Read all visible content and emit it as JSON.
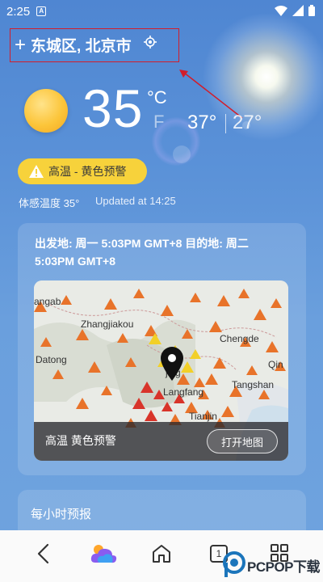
{
  "status_bar": {
    "time": "2:25",
    "notif": "A"
  },
  "location": {
    "name": "东城区, 北京市"
  },
  "weather": {
    "temp": "35",
    "unit_c": "°C",
    "unit_f": "F",
    "high": "37°",
    "low": "27°",
    "warning": "高温 - 黄色预警",
    "feels_like": "体感温度 35°",
    "updated": "Updated at 14:25"
  },
  "alert_card": {
    "text": "出发地: 周一 5:03PM GMT+8 目的地: 周二 5:03PM GMT+8",
    "map_label": "高温 黄色预警",
    "map_button": "打开地图",
    "map_cities": {
      "c1": "angab",
      "c2": "Zhangjiakou",
      "c3": "Chengde",
      "c4": "Datong",
      "c5": "jing",
      "c6": "Qin",
      "c7": "Langfang",
      "c8": "Tangshan",
      "c9": "Tianjin"
    }
  },
  "hourly": {
    "title": "每小时预报"
  },
  "nav": {
    "tab_count": "1"
  },
  "watermark": {
    "text": "PCPOP下载"
  },
  "colors": {
    "accent_warning": "#f7d23b",
    "highlight_box": "#d21d2a",
    "alert_orange": "#e8732a"
  }
}
